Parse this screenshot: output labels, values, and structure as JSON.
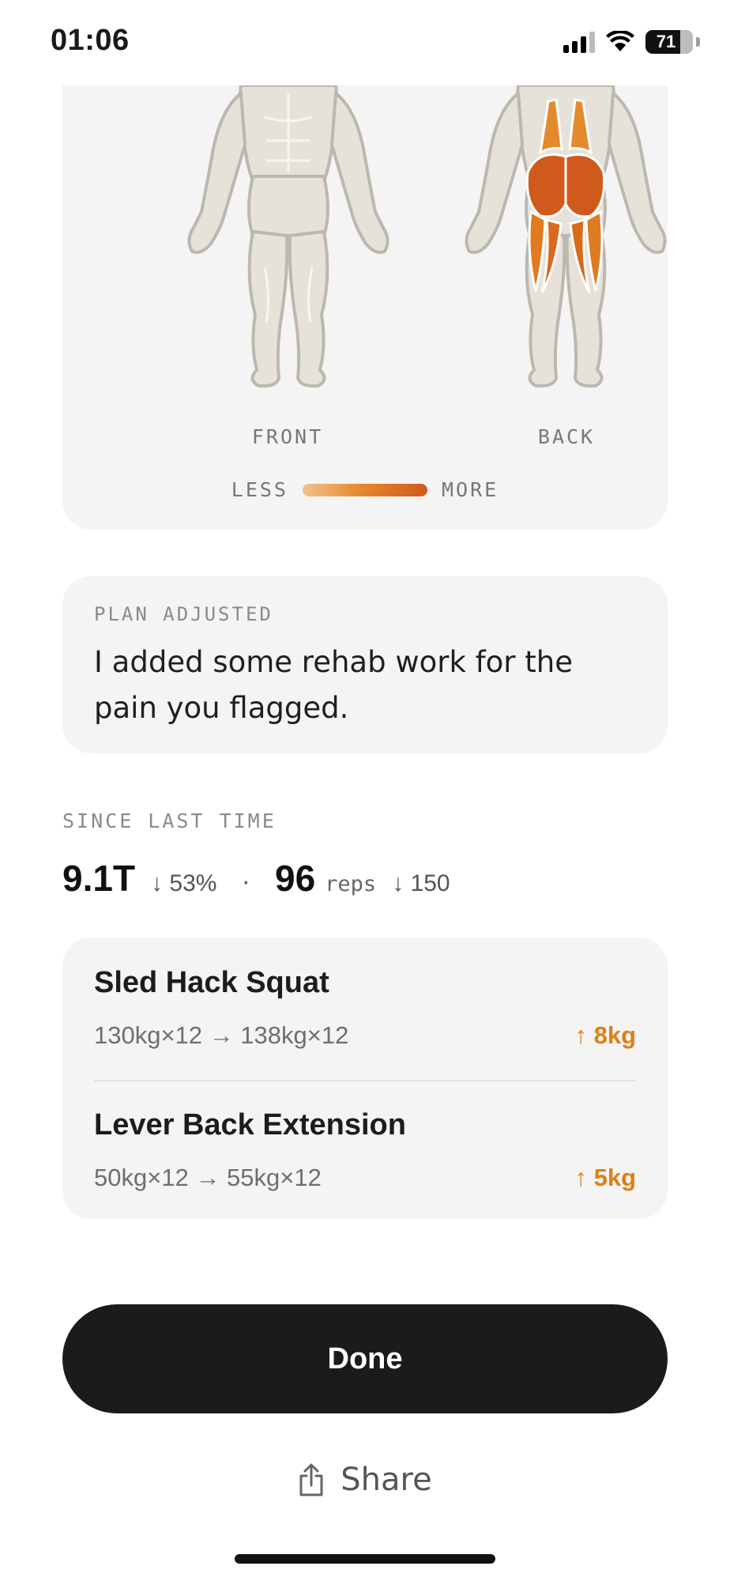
{
  "status_bar": {
    "time": "01:06",
    "battery": "71"
  },
  "muscle_map": {
    "front_label": "FRONT",
    "back_label": "BACK",
    "legend_less": "LESS",
    "legend_more": "MORE",
    "highlighted_muscles": [
      "glutes",
      "lower-back",
      "hamstrings"
    ],
    "colors": {
      "low": "#f2c28f",
      "mid": "#e58a2c",
      "high": "#cf5a1c",
      "body": "#e6e2da",
      "outline": "#bdb8ae"
    }
  },
  "plan_adjusted": {
    "title": "PLAN ADJUSTED",
    "message": "I added some rehab work for the pain you flagged."
  },
  "since_last_time": {
    "title": "SINCE LAST TIME",
    "volume": "9.1T",
    "volume_change": "↓ 53%",
    "separator": "·",
    "reps": "96",
    "reps_unit": "reps",
    "reps_change": "↓ 150"
  },
  "exercises": [
    {
      "name": "Sled Hack Squat",
      "detail": "130kg×12  →  138kg×12",
      "gain": "↑ 8kg"
    },
    {
      "name": "Lever Back Extension",
      "detail": "50kg×12  →  55kg×12",
      "gain": "↑ 5kg"
    }
  ],
  "actions": {
    "done_label": "Done",
    "share_label": "Share"
  },
  "accent_color": "#e07f12"
}
